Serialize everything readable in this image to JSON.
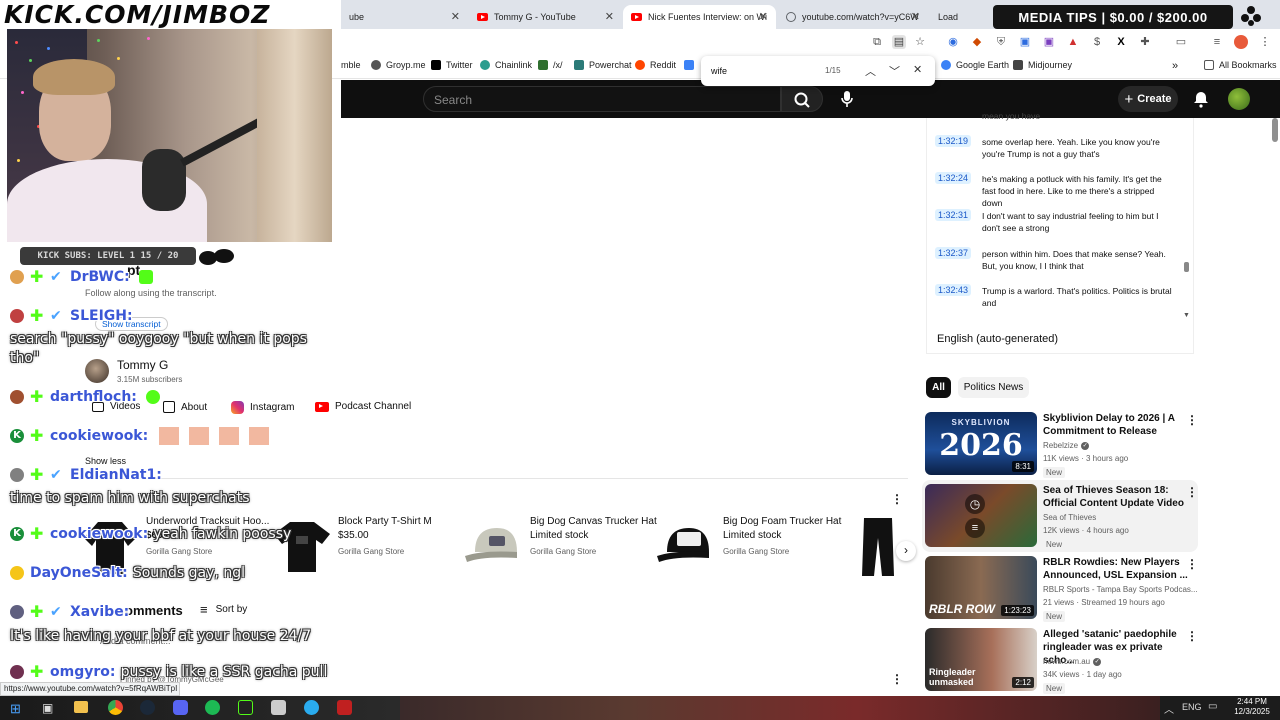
{
  "logo": {
    "text": "KICK.COM/JIMBOZ"
  },
  "tabs": [
    {
      "label": "ube",
      "type": "plain"
    },
    {
      "label": "Tommy G - YouTube",
      "type": "youtube"
    },
    {
      "label": "Nick Fuentes Interview: on Wi",
      "type": "youtube",
      "active": true
    },
    {
      "label": "youtube.com/watch?v=yC6W",
      "type": "globe"
    },
    {
      "label": "Load",
      "type": "plain"
    }
  ],
  "media_tips": {
    "text": "MEDIA TIPS | $0.00 / $200.00"
  },
  "bookmarks": [
    {
      "label": "mble",
      "color": "#888888"
    },
    {
      "label": "Groyp.me",
      "color": "#555555"
    },
    {
      "label": "Twitter",
      "color": "#000000"
    },
    {
      "label": "Chainlink",
      "color": "#2a9d8f"
    },
    {
      "label": "/x/",
      "color": "#2f6f2f"
    },
    {
      "label": "Powerchat",
      "color": "#2b7a78"
    },
    {
      "label": "Reddit",
      "color": "#ff4500"
    },
    {
      "label": "Google Earth",
      "color": "#3b82f6"
    },
    {
      "label": "Midjourney",
      "color": "#444444"
    },
    {
      "label": "All Bookmarks",
      "color": "#666666"
    }
  ],
  "find": {
    "query": "wife",
    "count": "1/15"
  },
  "yt": {
    "search_placeholder": "Search",
    "create_label": "Create",
    "transcript_title": "pt",
    "transcript_sub": "Follow along using the transcript.",
    "show_transcript": "Show transcript",
    "channel_name": "Tommy G",
    "subscribers": "3.15M subscribers",
    "channel_links": [
      "Videos",
      "About",
      "Instagram",
      "Podcast Channel"
    ],
    "show_less": "Show less",
    "products": [
      {
        "title": "Underworld Tracksuit Hoo...",
        "price": "$65.00",
        "store": "Gorilla Gang Store"
      },
      {
        "title": "Block Party T-Shirt M",
        "price": "$35.00",
        "store": "Gorilla Gang Store"
      },
      {
        "title": "Big Dog Canvas Trucker Hat",
        "price": "Limited stock",
        "store": "Gorilla Gang Store"
      },
      {
        "title": "Big Dog Foam Trucker Hat",
        "price": "Limited stock",
        "store": "Gorilla Gang Store"
      }
    ],
    "comments_label": "omments",
    "sort_by": "Sort by",
    "add_comment": "Add a comment...",
    "pinned_by": "Pinned by @TommyGMcGee",
    "status_url": "https://www.youtube.com/watch?v=5fRqAWBiTpI"
  },
  "transcript_lines": [
    {
      "time": "",
      "text": "mean you have"
    },
    {
      "time": "1:32:19",
      "text": "some overlap here. Yeah. Like you know you're you're Trump is not a guy that's"
    },
    {
      "time": "1:32:24",
      "text": "he's making a potluck with his family. It's get the fast food in here. Like to me there's a stripped down"
    },
    {
      "time": "1:32:31",
      "text": "I don't want to say industrial feeling to him but I don't see a strong"
    },
    {
      "time": "1:32:37",
      "text": "person within him. Does that make sense? Yeah. But, you know, I I think that"
    },
    {
      "time": "1:32:43",
      "text": "Trump is a warlord. That's politics. Politics is brutal and"
    }
  ],
  "language": "English (auto-generated)",
  "filters": [
    "All",
    "Politics News"
  ],
  "videos": [
    {
      "title": "Skyblivion Delay to 2026 | A Commitment to Release",
      "channel": "Rebelzize",
      "verified": true,
      "meta": "11K views · 3 hours ago",
      "badge": "New",
      "duration": "8:31",
      "thumb_text": "2026",
      "thumb_top": "SKYBLIVION"
    },
    {
      "title": "Sea of Thieves Season 18: Official Content Update Video",
      "channel": "Sea of Thieves",
      "verified": false,
      "meta": "12K views · 4 hours ago",
      "badge": "New",
      "duration": "",
      "thumb_text": "",
      "thumb_top": ""
    },
    {
      "title": "RBLR Rowdies: New Players Announced, USL Expansion ...",
      "channel": "RBLR Sports - Tampa Bay Sports Podcas...",
      "verified": false,
      "meta": "21 views · Streamed 19 hours ago",
      "badge": "New",
      "duration": "1:23:23",
      "thumb_text": "RBLR ROW",
      "thumb_top": ""
    },
    {
      "title": "Alleged 'satanic' paedophile ringleader was ex private scho...",
      "channel": "news.com.au",
      "verified": true,
      "meta": "34K views · 1 day ago",
      "badge": "New",
      "duration": "2:12",
      "thumb_text": "Ringleader unmasked",
      "thumb_top": ""
    }
  ],
  "kick_subs": {
    "text": "KICK SUBS: LEVEL 1 15 / 20"
  },
  "chat": [
    {
      "user": "DrBWC:",
      "message": ""
    },
    {
      "user": "SLEIGH:",
      "message": "search \"pussy\" ooygooy \"but when it pops tho\""
    },
    {
      "user": "darthfloch:",
      "message": ""
    },
    {
      "user": "cookiewook:",
      "message": ""
    },
    {
      "user": "EldianNat1:",
      "message": "time to spam him with superchats"
    },
    {
      "user": "cookiewook:",
      "message": "yeah fawkin poossy"
    },
    {
      "user": "DayOneSalt:",
      "message": "Sounds gay, ngl"
    },
    {
      "user": "Xavibe:",
      "message": "It's like having your bbf at your house 24/7"
    },
    {
      "user": "omgyro:",
      "message": "pussy is like a SSR gacha pull"
    }
  ],
  "taskbar": {
    "time": "2:44 PM",
    "date": "12/3/2025",
    "lang": "ENG"
  }
}
